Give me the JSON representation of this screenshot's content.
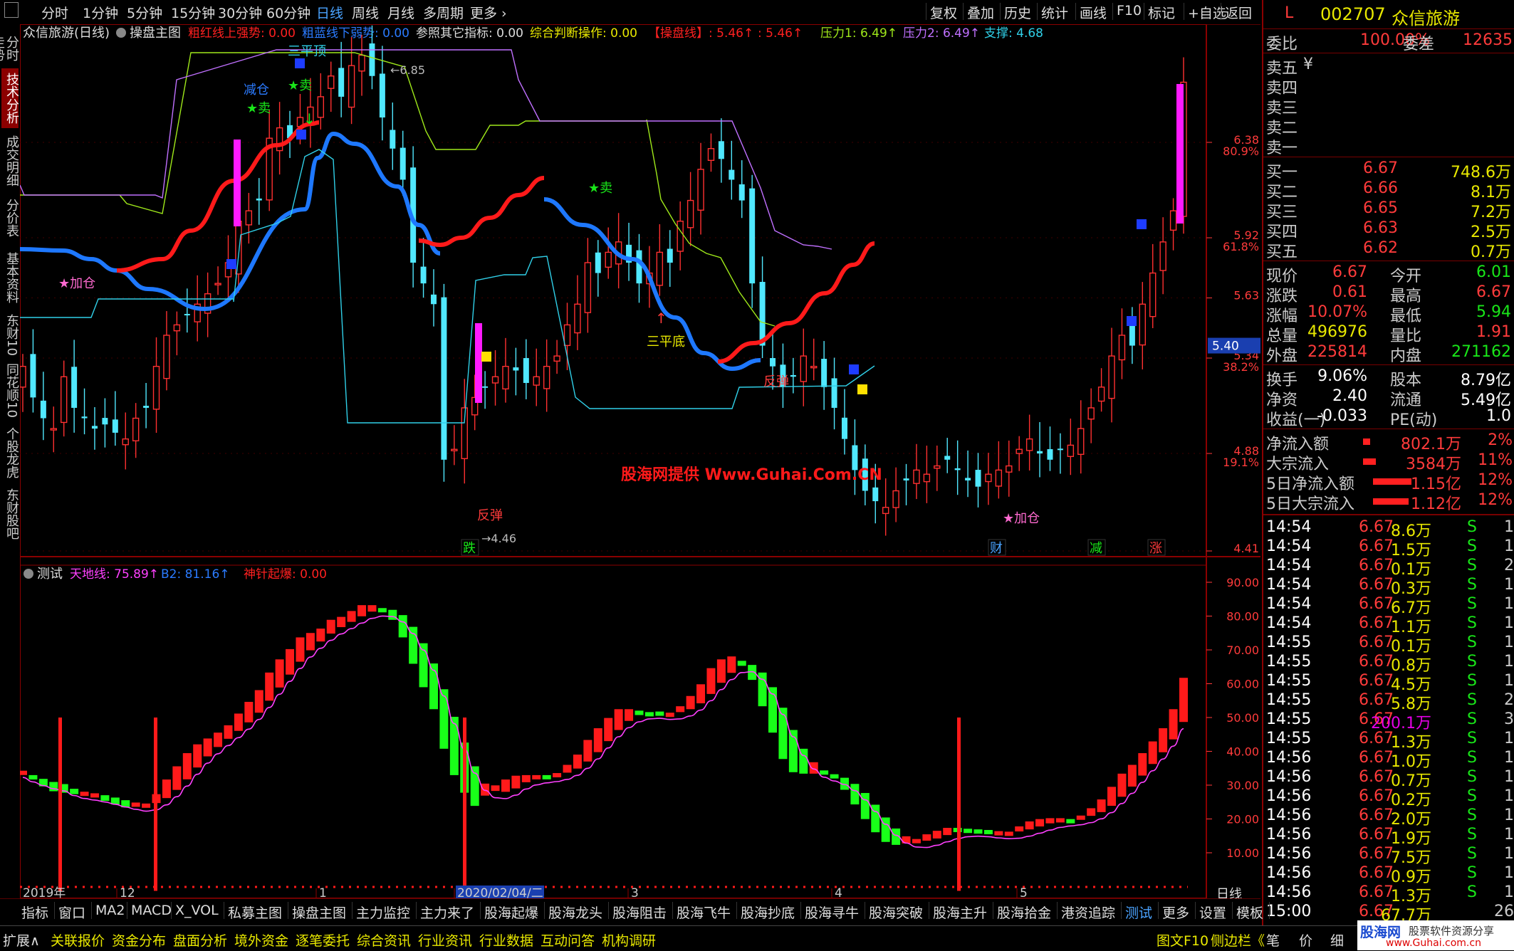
{
  "toolbar": {
    "periods": [
      "分时",
      "1分钟",
      "5分钟",
      "15分钟",
      "30分钟",
      "60分钟",
      "日线",
      "周线",
      "月线",
      "多周期",
      "更多"
    ],
    "active_period": "日线",
    "right_buttons": [
      "复权",
      "叠加",
      "历史",
      "统计",
      "画线",
      "F10",
      "标记",
      "+自选",
      "返回"
    ]
  },
  "left_tabs": [
    "分时走势",
    "技术分析",
    "成交明细",
    "分价表",
    "基本资料",
    "东财10",
    "同花顺10",
    "个股龙虎",
    "东财股吧"
  ],
  "main_chart": {
    "title": "众信旅游(日线)",
    "indicator_name": "操盘主图",
    "indicators": [
      {
        "label": "粗红线上强势: 0.00",
        "color": "#ff2020"
      },
      {
        "label": "粗蓝线下弱势: 0.00",
        "color": "#2b7bff"
      },
      {
        "label": "参照其它指标: 0.00",
        "color": "#dddddd"
      },
      {
        "label": "综合判断操作: 0.00",
        "color": "#e8e800"
      },
      {
        "label": "【操盘线】: 5.46↑",
        "color": "#ff2020"
      },
      {
        "label": ": 5.46↑",
        "color": "#ff2020"
      },
      {
        "label": "压力1: 6.49↑",
        "color": "#9fe81a"
      },
      {
        "label": "压力2: 6.49↑",
        "color": "#c070ff"
      },
      {
        "label": "支撑: 4.68",
        "color": "#30d0e8"
      }
    ],
    "y_labels": [
      {
        "price": "6.38",
        "pct": "80.9%"
      },
      {
        "price": "5.92",
        "pct": "61.8%"
      },
      {
        "price": "5.63",
        "pct": ""
      },
      {
        "price": "5.34",
        "pct": "38.2%"
      },
      {
        "price": "4.88",
        "pct": "19.1%"
      },
      {
        "price": "4.41",
        "pct": ""
      }
    ],
    "current_price_tag": "5.40",
    "high_label": "6.85",
    "low_label": "4.46",
    "annotations": {
      "top_triple": "三平顶",
      "reduce": "减仓",
      "sell1": "★卖",
      "sell2": "★卖",
      "sell3": "★卖",
      "add1": "★加仓",
      "add2": "★加仓",
      "rebound1": "反弹",
      "rebound2": "反弹",
      "bottom_triple": "三平底",
      "watermark": "股海网提供 Www.Guhai.Com.CN",
      "bottom_tags": [
        "跌",
        "财",
        "减",
        "涨"
      ]
    }
  },
  "sub_chart": {
    "name": "测试",
    "indicators": [
      {
        "label": "天地线: 75.89↑",
        "color": "#ff40ff"
      },
      {
        "label": "B2: 81.16↑",
        "color": "#2b7bff"
      },
      {
        "label": "神针起爆: 0.00",
        "color": "#ff2020"
      }
    ],
    "y_labels": [
      "90.00",
      "80.00",
      "70.00",
      "60.00",
      "50.00",
      "40.00",
      "30.00",
      "20.00",
      "10.00"
    ]
  },
  "x_axis": {
    "labels": [
      "2019年",
      "12",
      "1",
      "2020/02/04/二",
      "3",
      "4",
      "5"
    ],
    "right_label": "日线"
  },
  "chart_data": {
    "type": "candlestick",
    "close": [
      5.3,
      5.15,
      5.05,
      5.0,
      5.25,
      5.1,
      5.05,
      5.0,
      5.02,
      4.98,
      4.95,
      5.05,
      5.1,
      5.3,
      5.45,
      5.5,
      5.55,
      5.6,
      5.65,
      5.7,
      5.8,
      6.0,
      6.05,
      6.1,
      6.4,
      6.45,
      6.4,
      6.5,
      6.55,
      6.6,
      6.7,
      6.6,
      6.75,
      6.8,
      6.7,
      6.5,
      6.35,
      6.2,
      5.8,
      5.7,
      5.6,
      4.85,
      4.9,
      5.1,
      5.15,
      5.2,
      5.25,
      5.3,
      5.28,
      5.22,
      5.25,
      5.3,
      5.35,
      5.5,
      5.6,
      5.8,
      5.75,
      5.85,
      5.9,
      5.8,
      5.7,
      5.75,
      5.85,
      5.8,
      6.0,
      6.1,
      6.25,
      6.35,
      6.3,
      6.2,
      6.1,
      5.7,
      5.4,
      5.3,
      5.2,
      5.25,
      5.35,
      5.3,
      5.2,
      5.1,
      4.95,
      4.8,
      4.7,
      4.65,
      4.62,
      4.7,
      4.75,
      4.8,
      4.78,
      4.82,
      4.85,
      4.8,
      4.75,
      4.72,
      4.78,
      4.8,
      4.82,
      4.9,
      4.95,
      4.88,
      4.85,
      4.9,
      4.92,
      5.0,
      5.1,
      5.2,
      5.35,
      5.45,
      5.4,
      5.6,
      5.75,
      5.9,
      6.05,
      6.67
    ],
    "ylim": [
      4.41,
      6.85
    ],
    "lines": [
      "粗红线",
      "粗蓝线",
      "压力1",
      "压力2",
      "支撑"
    ]
  },
  "quote": {
    "code": "002707",
    "name": "众信旅游",
    "webi_label": "委比",
    "webi": "100.00%",
    "weicha_label": "委差",
    "weicha": "12635",
    "sells": [
      {
        "label": "卖五",
        "price": "¥",
        "vol": ""
      },
      {
        "label": "卖四",
        "price": "",
        "vol": ""
      },
      {
        "label": "卖三",
        "price": "",
        "vol": ""
      },
      {
        "label": "卖二",
        "price": "",
        "vol": ""
      },
      {
        "label": "卖一",
        "price": "",
        "vol": ""
      }
    ],
    "buys": [
      {
        "label": "买一",
        "price": "6.67",
        "vol": "748.6万"
      },
      {
        "label": "买二",
        "price": "6.66",
        "vol": "8.1万"
      },
      {
        "label": "买三",
        "price": "6.65",
        "vol": "7.2万"
      },
      {
        "label": "买四",
        "price": "6.63",
        "vol": "2.5万"
      },
      {
        "label": "买五",
        "price": "6.62",
        "vol": "0.7万"
      }
    ],
    "stats": [
      {
        "l1": "现价",
        "v1": "6.67",
        "c1": "red",
        "l2": "今开",
        "v2": "6.01",
        "c2": "green"
      },
      {
        "l1": "涨跌",
        "v1": "0.61",
        "c1": "red",
        "l2": "最高",
        "v2": "6.67",
        "c2": "red"
      },
      {
        "l1": "涨幅",
        "v1": "10.07%",
        "c1": "red",
        "l2": "最低",
        "v2": "5.94",
        "c2": "green"
      },
      {
        "l1": "总量",
        "v1": "496976",
        "c1": "yellow",
        "l2": "量比",
        "v2": "1.91",
        "c2": "red"
      },
      {
        "l1": "外盘",
        "v1": "225814",
        "c1": "red",
        "l2": "内盘",
        "v2": "271162",
        "c2": "green"
      }
    ],
    "stats2": [
      {
        "l1": "换手",
        "v1": "9.06%",
        "l2": "股本",
        "v2": "8.79亿"
      },
      {
        "l1": "净资",
        "v1": "2.40",
        "l2": "流通",
        "v2": "5.49亿"
      },
      {
        "l1": "收益(一)",
        "v1": "-0.033",
        "l2": "PE(动)",
        "v2": "1.0"
      }
    ],
    "flows": [
      {
        "label": "净流入额",
        "value": "802.1万",
        "pct": "2%",
        "bar": 0.05
      },
      {
        "label": "大宗流入",
        "value": "3584万",
        "pct": "11%",
        "bar": 0.15
      },
      {
        "label": "5日净流入额",
        "value": "1.15亿",
        "pct": "12%",
        "bar": 0.6
      },
      {
        "label": "5日大宗流入",
        "value": "1.12亿",
        "pct": "12%",
        "bar": 0.55
      }
    ],
    "ticks": [
      {
        "t": "14:54",
        "p": "6.67",
        "v": "8.6万",
        "s": "S",
        "n": "1"
      },
      {
        "t": "14:54",
        "p": "6.67",
        "v": "1.5万",
        "s": "S",
        "n": "1"
      },
      {
        "t": "14:54",
        "p": "6.67",
        "v": "0.1万",
        "s": "S",
        "n": "2"
      },
      {
        "t": "14:54",
        "p": "6.67",
        "v": "0.3万",
        "s": "S",
        "n": "1"
      },
      {
        "t": "14:54",
        "p": "6.67",
        "v": "6.7万",
        "s": "S",
        "n": "1"
      },
      {
        "t": "14:54",
        "p": "6.67",
        "v": "1.1万",
        "s": "S",
        "n": "1"
      },
      {
        "t": "14:55",
        "p": "6.67",
        "v": "0.1万",
        "s": "S",
        "n": "1"
      },
      {
        "t": "14:55",
        "p": "6.67",
        "v": "0.8万",
        "s": "S",
        "n": "1"
      },
      {
        "t": "14:55",
        "p": "6.67",
        "v": "4.5万",
        "s": "S",
        "n": "1"
      },
      {
        "t": "14:55",
        "p": "6.67",
        "v": "5.8万",
        "s": "S",
        "n": "2"
      },
      {
        "t": "14:55",
        "p": "6.67",
        "v": "200.1万",
        "s": "S",
        "n": "3",
        "vc": "magenta"
      },
      {
        "t": "14:55",
        "p": "6.67",
        "v": "1.3万",
        "s": "S",
        "n": "1"
      },
      {
        "t": "14:56",
        "p": "6.67",
        "v": "1.0万",
        "s": "S",
        "n": "1"
      },
      {
        "t": "14:56",
        "p": "6.67",
        "v": "0.7万",
        "s": "S",
        "n": "1"
      },
      {
        "t": "14:56",
        "p": "6.67",
        "v": "0.2万",
        "s": "S",
        "n": "1"
      },
      {
        "t": "14:56",
        "p": "6.67",
        "v": "2.0万",
        "s": "S",
        "n": "1"
      },
      {
        "t": "14:56",
        "p": "6.67",
        "v": "1.9万",
        "s": "S",
        "n": "1"
      },
      {
        "t": "14:56",
        "p": "6.67",
        "v": "7.5万",
        "s": "S",
        "n": "1"
      },
      {
        "t": "14:56",
        "p": "6.67",
        "v": "0.9万",
        "s": "S",
        "n": "1"
      },
      {
        "t": "14:56",
        "p": "6.67",
        "v": "1.3万",
        "s": "S",
        "n": "1"
      },
      {
        "t": "15:00",
        "p": "6.67",
        "v": "67.7万",
        "s": "",
        "n": "26"
      }
    ]
  },
  "bottom_tabs": [
    "指标",
    "窗口",
    "MA2",
    "MACD",
    "X_VOL",
    "私募主图",
    "操盘主图",
    "主力监控",
    "主力来了",
    "股海起爆",
    "股海龙头",
    "股海阻击",
    "股海飞牛",
    "股海抄底",
    "股海寻牛",
    "股海突破",
    "股海主升",
    "股海拾金",
    "港资追踪",
    "测试",
    "更多",
    "设置",
    "模板"
  ],
  "bottom_tabs_active": "测试",
  "status_items": [
    "扩展∧",
    "关联报价",
    "资金分布",
    "盘面分析",
    "境外资金",
    "逐笔委托",
    "综合资讯",
    "行业资讯",
    "行业数据",
    "互动问答",
    "机构调研"
  ],
  "status_right": [
    "图文F10",
    "侧边栏《",
    "笔",
    "价",
    "细"
  ],
  "brand": {
    "name": "股海网",
    "slogan": "股票软件资源分享",
    "url": "www.Guhai.com.cn"
  }
}
